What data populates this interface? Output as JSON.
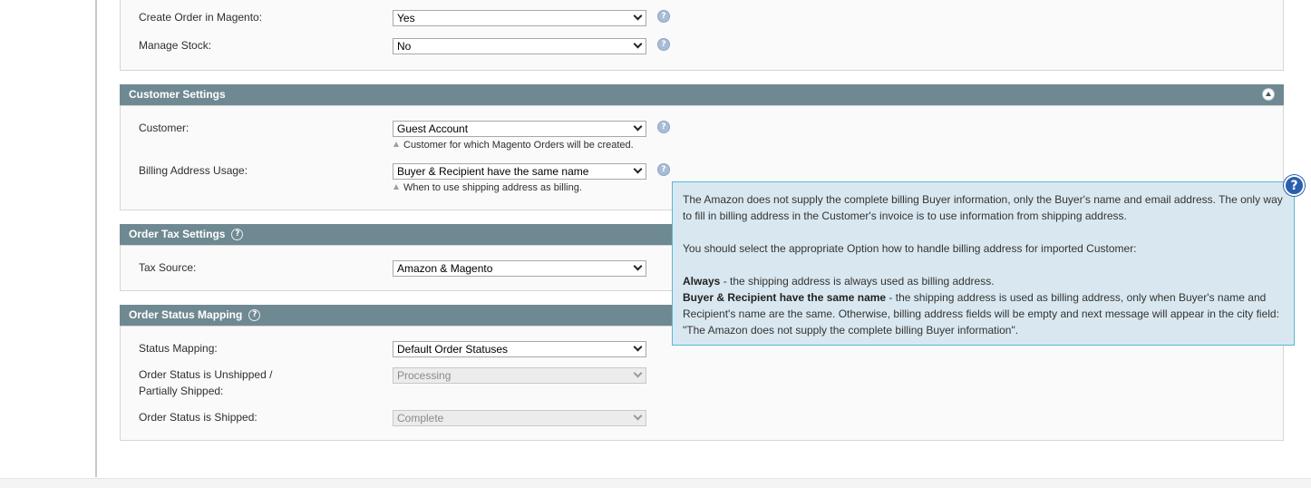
{
  "general": {
    "create_order_label": "Create Order in Magento:",
    "create_order_value": "Yes",
    "manage_stock_label": "Manage Stock:",
    "manage_stock_value": "No"
  },
  "customer_settings": {
    "title": "Customer Settings",
    "customer_label": "Customer:",
    "customer_value": "Guest Account",
    "customer_note": "Customer for which Magento Orders will be created.",
    "billing_label": "Billing Address Usage:",
    "billing_value": "Buyer & Recipient have the same name",
    "billing_note": "When to use shipping address as billing."
  },
  "tax_settings": {
    "title": "Order Tax Settings",
    "tax_source_label": "Tax Source:",
    "tax_source_value": "Amazon & Magento"
  },
  "status_mapping": {
    "title": "Order Status Mapping",
    "mapping_label": "Status Mapping:",
    "mapping_value": "Default Order Statuses",
    "unshipped_label_line1": "Order Status is Unshipped /",
    "unshipped_label_line2": "Partially Shipped:",
    "unshipped_value": "Processing",
    "shipped_label": "Order Status is Shipped:",
    "shipped_value": "Complete"
  },
  "tooltip": {
    "para1": "The Amazon does not supply the complete billing Buyer information, only the Buyer's name and email address. The only way to fill in billing address in the Customer's invoice is to use information from shipping address.",
    "para2": "You should select the appropriate Option how to handle billing address for imported Customer:",
    "always_term": "Always",
    "always_desc": " - the shipping address is always used as billing address.",
    "same_name_term": "Buyer & Recipient have the same name",
    "same_name_desc": " - the shipping address is used as billing address, only when Buyer's name and Recipient's name are the same. Otherwise, billing address fields will be empty and next message will appear in the city field: \"The Amazon does not supply the complete billing Buyer information\"."
  },
  "icons": {
    "field_help": "question-circle-icon",
    "collapse": "collapse-arrow-icon",
    "tooltip_help": "question-badge-icon"
  },
  "colors": {
    "section_header": "#6f8992",
    "tooltip_bg": "#d9e8f0",
    "tooltip_border": "#58b6d6"
  }
}
